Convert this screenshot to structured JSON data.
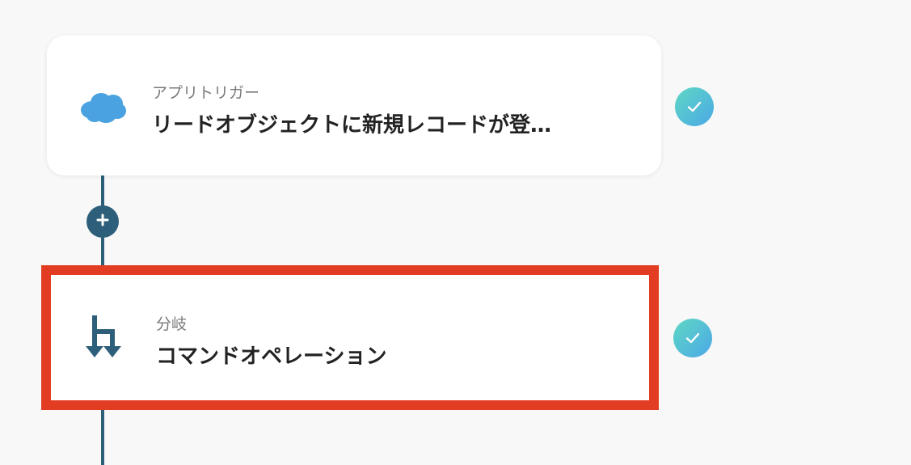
{
  "flow": {
    "steps": [
      {
        "label": "アプリトリガー",
        "title": "リードオブジェクトに新規レコードが登…",
        "icon": "salesforce-cloud-icon",
        "status": "completed",
        "accent_color": "#4aa3e0"
      },
      {
        "label": "分岐",
        "title": "コマンドオペレーション",
        "icon": "branch-icon",
        "status": "completed",
        "selected": true,
        "accent_color": "#2e5f7a"
      }
    ],
    "add_step_icon": "plus-icon"
  },
  "colors": {
    "connector": "#2e5f7a",
    "highlight_border": "#e23d22",
    "check_gradient_start": "#5fd8c4",
    "check_gradient_end": "#4ba8e6"
  }
}
